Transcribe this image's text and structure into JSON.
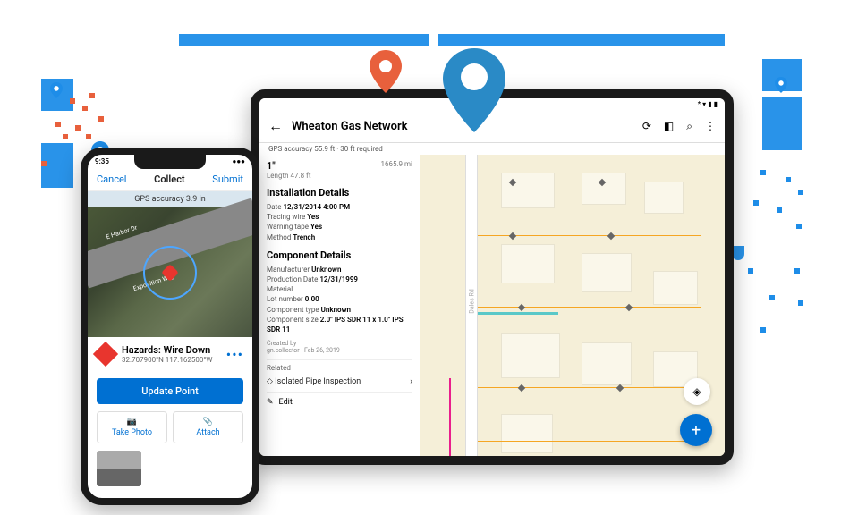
{
  "phone": {
    "status_time": "9:35",
    "cancel": "Cancel",
    "title": "Collect",
    "submit": "Submit",
    "gps_banner": "GPS accuracy 3.9 in",
    "map_labels": {
      "harbor": "E Harbor Dr",
      "expo": "Exposition Way"
    },
    "hazard": {
      "title": "Hazards: Wire Down",
      "coords": "32.707900°N 117.162500°W"
    },
    "update_btn": "Update Point",
    "take_photo": "Take Photo",
    "attach": "Attach"
  },
  "tablet": {
    "title": "Wheaton Gas Network",
    "gps_banner": "GPS accuracy 55.9 ft · 30 ft required",
    "panel": {
      "size": "1\"",
      "length": "Length 47.8 ft",
      "distance": "1665.9 mi",
      "section_install": "Installation Details",
      "install": {
        "date_lbl": "Date",
        "date": "12/31/2014 4:00 PM",
        "tracing_lbl": "Tracing wire",
        "tracing": "Yes",
        "warning_lbl": "Warning tape",
        "warning": "Yes",
        "method_lbl": "Method",
        "method": "Trench"
      },
      "section_component": "Component Details",
      "component": {
        "manu_lbl": "Manufacturer",
        "manu": "Unknown",
        "prod_lbl": "Production Date",
        "prod": "12/31/1999",
        "material_lbl": "Material",
        "lot_lbl": "Lot number",
        "lot": "0.00",
        "ctype_lbl": "Component type",
        "ctype": "Unknown",
        "csize_lbl": "Component size",
        "csize": "2.0\" IPS SDR 11 x 1.0\" IPS SDR 11"
      },
      "created_by": "Created by",
      "created_meta": "gn.collector · Feb 26, 2019",
      "related": "Related",
      "related_item": "Isolated Pipe Inspection",
      "edit": "Edit"
    },
    "map": {
      "road_label": "Dales Rd"
    },
    "fab": "+"
  }
}
